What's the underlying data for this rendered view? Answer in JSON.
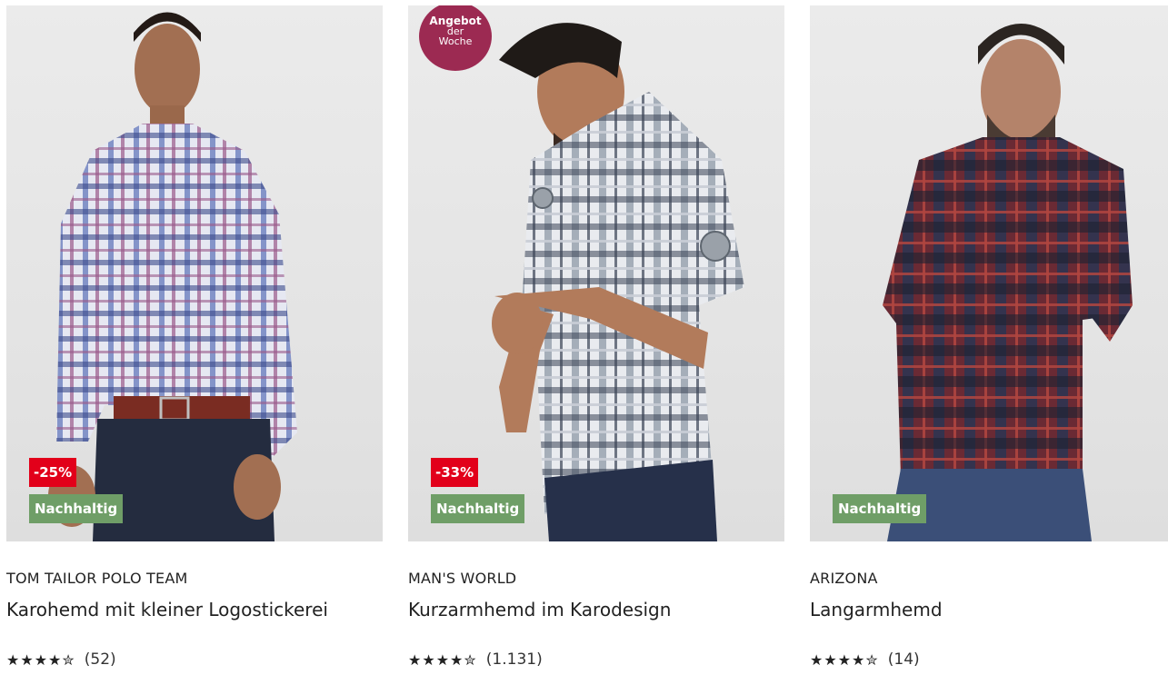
{
  "products": [
    {
      "brand": "TOM TAILOR POLO TEAM",
      "title": "Karohemd mit kleiner Logostickerei",
      "discount": "-25%",
      "sustainable": "Nachhaltig",
      "stars": "★★★★✮",
      "rating": 4.5,
      "reviews": "(52)",
      "shirt_colors": [
        "#6b7fbf",
        "#3a4a8a",
        "#9a5a8a",
        "#e6e8f2"
      ]
    },
    {
      "brand": "MAN'S WORLD",
      "title": "Kurzarmhemd im Karodesign",
      "discount": "-33%",
      "sustainable": "Nachhaltig",
      "stars": "★★★★✮",
      "rating": 4.5,
      "reviews": "(1.131)",
      "offer_badge": [
        "Angebot",
        "der",
        "Woche"
      ],
      "shirt_colors": [
        "#8f99a6",
        "#3b4356",
        "#c9ced6",
        "#e9ebef"
      ]
    },
    {
      "brand": "ARIZONA",
      "title": "Langarmhemd",
      "sustainable": "Nachhaltig",
      "stars": "★★★★✮",
      "rating": 4.5,
      "reviews": "(14)",
      "shirt_colors": [
        "#6a2a34",
        "#2a3552",
        "#b0453f",
        "#1d2130"
      ]
    }
  ],
  "colors": {
    "discount_bg": "#e2001a",
    "sustainable_bg": "#6f9e67",
    "offer_badge_bg": "#9c2a52"
  }
}
